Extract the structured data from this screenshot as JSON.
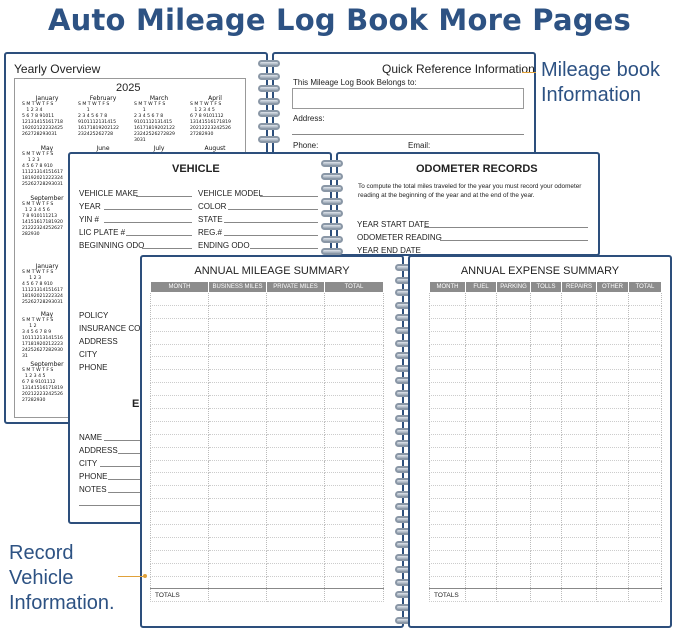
{
  "header": {
    "title": "Auto Mileage Log Book More Pages"
  },
  "yearly": {
    "title": "Yearly Overview",
    "year": "2025",
    "weekdays": "S M T W T F S",
    "months_row1": [
      "January",
      "February",
      "March",
      "April"
    ],
    "months_row2": [
      "May",
      "June",
      "July",
      "August"
    ],
    "left_months": [
      "September",
      "January",
      "May",
      "September"
    ],
    "jan_days": [
      "   1 2 3 4",
      "5 6 7 8 91011",
      "12131415161718",
      "19202122232425",
      "262728293031"
    ],
    "feb_days": [
      "      1",
      "2 3 4 5 6 7 8",
      "9101112131415",
      "16171819202122",
      "232425262728"
    ],
    "mar_days": [
      "      1",
      "2 3 4 5 6 7 8",
      "9101112131415",
      "16171819202122",
      "23242526272829",
      "3031"
    ],
    "apr_days": [
      "   1 2 3 4 5",
      "6 7 8 9101112",
      "13141516171819",
      "20212223242526",
      "27282930"
    ],
    "may_days": [
      "    1 2 3",
      "4 5 6 7 8 910",
      "11121314151617",
      "18192021222324",
      "25262728293031"
    ],
    "sep_days": [
      "  1 2 3 4 5 6",
      "7 8 910111213",
      "14151617181920",
      "21222324252627",
      "282930"
    ],
    "jan2_days": [
      "     1 2 3",
      "4 5 6 7 8 910",
      "11121314151617",
      "18192021222324",
      "25262728293031"
    ],
    "may2_days": [
      "     1 2",
      "3 4 5 6 7 8 9",
      "10111213141516",
      "17181920212223",
      "24252627282930",
      "31"
    ],
    "sep2_days": [
      "  1 2 3 4 5",
      "6 7 8 9101112",
      "13141516171819",
      "20212223242526",
      "27282930"
    ]
  },
  "quickref": {
    "title": "Quick Reference Information",
    "belongs": "This Mileage Log Book Belongs to:",
    "address": "Address:",
    "phone": "Phone:",
    "email": "Email:"
  },
  "vehicle": {
    "title": "VEHICLE",
    "left_fields": [
      "VEHICLE MAKE",
      "YEAR",
      "YIN #",
      "LIC PLATE #",
      "BEGINNING ODO"
    ],
    "right_fields": [
      "VEHICLE MODEL",
      "COLOR",
      "STATE",
      "REG.#",
      "ENDING ODO"
    ],
    "insurance_fields": [
      "POLICY",
      "INSURANCE CO.",
      "ADDRESS",
      "CITY",
      "PHONE"
    ],
    "contact_initial": "E",
    "contact_fields": [
      "NAME",
      "ADDRESS",
      "CITY",
      "PHONE",
      "NOTES"
    ]
  },
  "odometer": {
    "title": "ODOMETER RECORDS",
    "desc": "To compute the total miles traveled for the year you must record your odometer reading at the beginning of the year and at the end of the year.",
    "fields": [
      "YEAR START DATE",
      "ODOMETER READING",
      "YEAR END DATE"
    ]
  },
  "mileage": {
    "title": "ANNUAL MILEAGE SUMMARY",
    "columns": [
      "MONTH",
      "BUSINESS MILES",
      "PRIVATE MILES",
      "TOTAL"
    ],
    "totals_label": "TOTALS"
  },
  "expense": {
    "title": "ANNUAL EXPENSE SUMMARY",
    "columns": [
      "MONTH",
      "FUEL",
      "PARKING",
      "TOLLS",
      "REPAIRS",
      "OTHER",
      "TOTAL"
    ],
    "totals_label": "TOTALS"
  },
  "callouts": {
    "mileage_book": [
      "Mileage book",
      "Information"
    ],
    "record_vehicle": [
      "Record",
      "Vehicle",
      "Information."
    ]
  },
  "colors": {
    "brand_blue": "#2d5283",
    "page_border": "#2d4f7c",
    "header_gray": "#8c8c8c"
  }
}
